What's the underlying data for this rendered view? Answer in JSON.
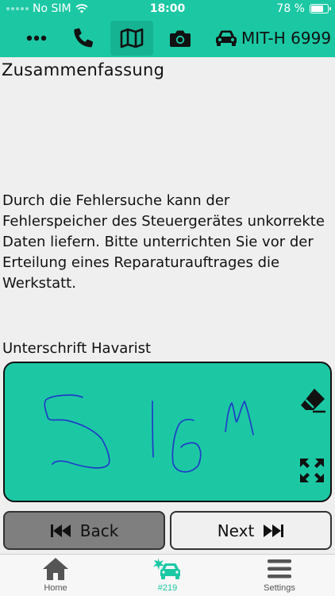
{
  "status_bar": {
    "carrier": "No SIM",
    "time": "18:00",
    "battery_percent": "78 %",
    "battery_level": 0.78
  },
  "toolbar": {
    "icons": [
      "more-icon",
      "phone-icon",
      "map-icon",
      "camera-icon",
      "car-icon"
    ],
    "plate": "MIT-H 6999",
    "active_item": "map"
  },
  "content": {
    "heading": "Zusammenfassung",
    "body": "Durch die Fehlersuche kann der Fehlerspeicher des Steuergerätes unkorrekte Daten liefern. Bitte unterrichten Sie vor der Erteilung eines Reparaturauftrages die Werkstatt.",
    "signature_label": "Unterschrift Havarist"
  },
  "signature_pad": {
    "background": "#1cc8a4",
    "stroke_color": "#1f3cc8",
    "tools": [
      "eraser-icon",
      "expand-icon"
    ]
  },
  "buttons": {
    "back_label": "Back",
    "next_label": "Next"
  },
  "tabbar": {
    "items": [
      {
        "label": "Home",
        "icon": "home-icon"
      },
      {
        "label": "#219",
        "icon": "car-crash-icon"
      },
      {
        "label": "Settings",
        "icon": "menu-icon"
      }
    ],
    "active": "#219"
  },
  "colors": {
    "accent": "#1cc8a4",
    "back_button": "#7f7f7f",
    "next_button": "#f0f0f0"
  }
}
